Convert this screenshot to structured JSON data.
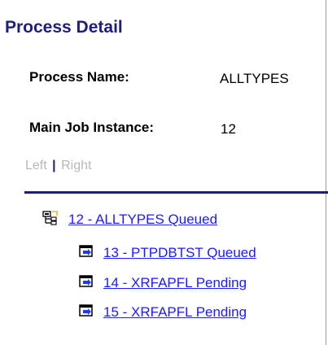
{
  "page": {
    "title": "Process Detail"
  },
  "fields": {
    "process_name_label": "Process Name:",
    "process_name_value": "ALLTYPES",
    "main_job_label": "Main Job Instance:",
    "main_job_value": "12"
  },
  "nav": {
    "left": "Left",
    "separator": "|",
    "right": "Right"
  },
  "tree": {
    "root": {
      "label": "12 - ALLTYPES Queued",
      "icon": "jobset-icon"
    },
    "children": [
      {
        "label": "13 - PTPDBTST Queued",
        "icon": "process-icon"
      },
      {
        "label": "14 - XRFAPFL Pending",
        "icon": "process-icon"
      },
      {
        "label": "15 - XRFAPFL Pending",
        "icon": "process-icon"
      }
    ]
  },
  "colors": {
    "title": "#1f1f7a",
    "link": "#1a1aff",
    "rule": "#1c1c7a",
    "nav_disabled": "#b8b8b8"
  }
}
